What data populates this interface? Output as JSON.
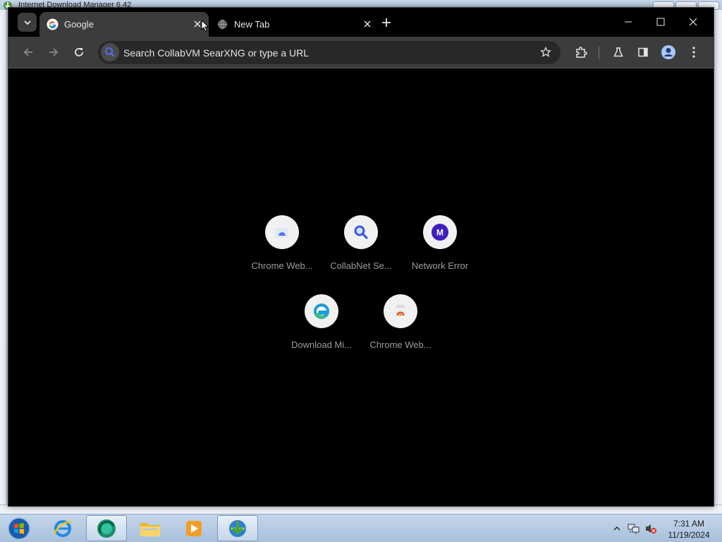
{
  "background_window": {
    "title": "Internet Download Manager 6.42"
  },
  "browser": {
    "tabs": [
      {
        "title": "Google",
        "favicon": "google-g-icon",
        "active": true
      },
      {
        "title": "New Tab",
        "favicon": "globe-icon",
        "active": false
      }
    ],
    "omnibox": {
      "placeholder": "Search CollabVM SearXNG or type a URL"
    },
    "toolbar_icons": [
      "back-arrow-icon",
      "forward-arrow-icon",
      "reload-icon",
      "star-icon",
      "extensions-puzzle-icon",
      "labs-flask-icon",
      "side-panel-icon",
      "profile-avatar-icon",
      "kebab-menu-icon"
    ],
    "window_controls": [
      "minimize-icon",
      "maximize-icon",
      "close-icon"
    ]
  },
  "new_tab_page": {
    "shortcuts": [
      {
        "label": "Chrome Web...",
        "icon": "chrome-web-store-icon"
      },
      {
        "label": "CollabNet Se...",
        "icon": "magnifier-search-icon"
      },
      {
        "label": "Network Error",
        "icon": "letter-m-icon",
        "letter": "M"
      },
      {
        "label": "Download Mi...",
        "icon": "microsoft-edge-icon"
      },
      {
        "label": "Chrome Web...",
        "icon": "chrome-web-store-icon"
      }
    ]
  },
  "taskbar": {
    "apps": [
      "start-orb",
      "internet-explorer-icon",
      "browser-app-icon",
      "file-explorer-icon",
      "media-player-icon",
      "internet-download-manager-icon"
    ],
    "clock": {
      "time": "7:31 AM",
      "date": "11/19/2024"
    }
  },
  "colors": {
    "page_background": "#000000",
    "tab_active": "#3c3c3c",
    "omnibox": "#282828",
    "shortcut_circle": "#f1f1f1",
    "m_badge": "#3e1fbf",
    "taskbar": "#b8cce4"
  }
}
